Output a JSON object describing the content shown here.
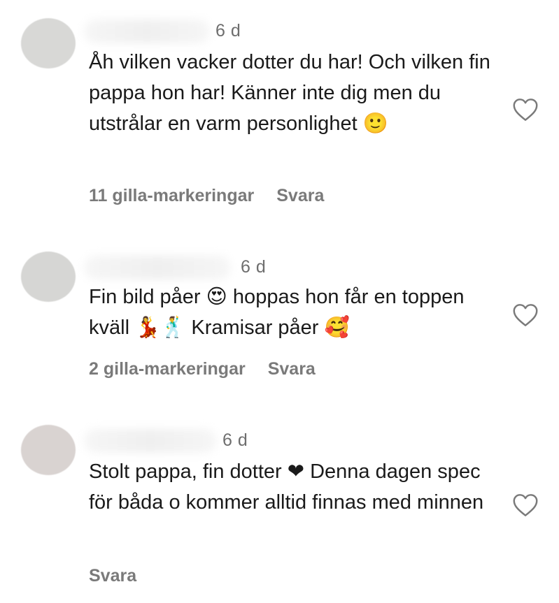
{
  "comments": [
    {
      "time": "6 d",
      "text": "Åh vilken vacker dotter du har! Och vilken fin pappa hon har! Känner inte dig men du utstrålar en varm personlighet 🙂",
      "likes": "11 gilla-markeringar",
      "reply": "Svara"
    },
    {
      "time": "6 d",
      "text": "Fin bild påer 😍 hoppas hon får en toppen kväll 💃🕺 Kramisar påer 🥰",
      "likes": "2 gilla-markeringar",
      "reply": "Svara"
    },
    {
      "time": "6 d",
      "text": "Stolt pappa, fin dotter ❤ Denna dagen spec för båda o kommer alltid finnas med minnen",
      "likes": "",
      "reply": "Svara"
    }
  ],
  "icons": {
    "like": "heart-outline-icon"
  }
}
